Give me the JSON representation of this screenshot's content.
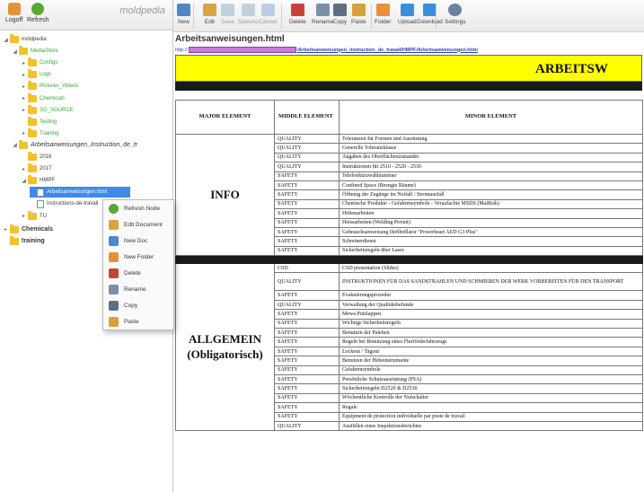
{
  "left_toolbar": {
    "logoff": "Logoff",
    "refresh": "Refresh",
    "logo": "moldpedia"
  },
  "tree": [
    {
      "label": "moldpedia",
      "indent": 0,
      "tw": "◢",
      "kind": "folder",
      "style": "root"
    },
    {
      "label": "MediaStore",
      "indent": 1,
      "tw": "◢",
      "kind": "folder",
      "style": "green"
    },
    {
      "label": "Configs",
      "indent": 2,
      "tw": "▸",
      "kind": "folder",
      "style": "green"
    },
    {
      "label": "Logs",
      "indent": 2,
      "tw": "▸",
      "kind": "folder",
      "style": "green"
    },
    {
      "label": "Pictures_Videos",
      "indent": 2,
      "tw": "▸",
      "kind": "folder",
      "style": "green"
    },
    {
      "label": "Chemicals",
      "indent": 2,
      "tw": "▸",
      "kind": "folder",
      "style": "green"
    },
    {
      "label": "SG_SOURCE",
      "indent": 2,
      "tw": "▸",
      "kind": "folder",
      "style": "green"
    },
    {
      "label": "Testing",
      "indent": 2,
      "tw": "",
      "kind": "folder",
      "style": "green"
    },
    {
      "label": "Training",
      "indent": 2,
      "tw": "▸",
      "kind": "folder",
      "style": "green"
    },
    {
      "label": "Arbeitsanweisungen_Instruction_de_tr",
      "indent": 1,
      "tw": "◢",
      "kind": "folder",
      "style": "big"
    },
    {
      "label": "2016",
      "indent": 2,
      "tw": "",
      "kind": "folder",
      "style": ""
    },
    {
      "label": "2017",
      "indent": 2,
      "tw": "▸",
      "kind": "folder",
      "style": ""
    },
    {
      "label": "HMPF",
      "indent": 2,
      "tw": "◢",
      "kind": "folder",
      "style": ""
    },
    {
      "label": "Arbeitsanweisungen.html",
      "indent": 3,
      "tw": "",
      "kind": "file",
      "style": "sel"
    },
    {
      "label": "Instructions-de-travail",
      "indent": 3,
      "tw": "",
      "kind": "file",
      "style": ""
    },
    {
      "label": "TU",
      "indent": 2,
      "tw": "▸",
      "kind": "folder",
      "style": ""
    },
    {
      "label": "Chemicals",
      "indent": 0,
      "tw": "▸",
      "kind": "folder",
      "style": "bold"
    },
    {
      "label": "training",
      "indent": 0,
      "tw": "",
      "kind": "folder",
      "style": "bold"
    }
  ],
  "context_menu": [
    {
      "label": "Refresh Node",
      "icon": "refresh-node-icon",
      "color": "#5aa832"
    },
    {
      "label": "Edit Document",
      "icon": "edit-document-icon",
      "color": "#d9a441"
    },
    {
      "label": "New Doc",
      "icon": "new-doc-icon",
      "color": "#4f86c6"
    },
    {
      "label": "New Folder",
      "icon": "new-folder-icon",
      "color": "#e8903a"
    },
    {
      "label": "Delete",
      "icon": "delete-icon",
      "color": "#c9413b"
    },
    {
      "label": "Rename",
      "icon": "rename-icon",
      "color": "#7b8fa8"
    },
    {
      "label": "Copy",
      "icon": "copy-icon",
      "color": "#5f6e80"
    },
    {
      "label": "Paste",
      "icon": "paste-icon",
      "color": "#d7a23a"
    }
  ],
  "toolbar": [
    {
      "label": "New",
      "icon": "new-icon",
      "color": "#4f86c6",
      "enabled": true
    },
    {
      "label": "Edit",
      "icon": "edit-icon",
      "color": "#d9a441",
      "enabled": true
    },
    {
      "label": "Save",
      "icon": "save-icon",
      "color": "#8aa2c4",
      "enabled": false
    },
    {
      "label": "SaveAs",
      "icon": "save-as-icon",
      "color": "#8aa2c4",
      "enabled": false
    },
    {
      "label": "Cancel",
      "icon": "cancel-icon",
      "color": "#6ea0d8",
      "enabled": false
    },
    {
      "label": "Delete",
      "icon": "delete-icon",
      "color": "#c9413b",
      "enabled": true
    },
    {
      "label": "Rename",
      "icon": "rename-icon",
      "color": "#7b8fa8",
      "enabled": true
    },
    {
      "label": "Copy",
      "icon": "copy-icon",
      "color": "#5f6e80",
      "enabled": true
    },
    {
      "label": "Paste",
      "icon": "paste-icon",
      "color": "#d7a23a",
      "enabled": true
    },
    {
      "label": "Folder",
      "icon": "folder-icon",
      "color": "#e8903a",
      "enabled": true
    },
    {
      "label": "Upload",
      "icon": "upload-icon",
      "color": "#3a8fd9",
      "enabled": true
    },
    {
      "label": "Download",
      "icon": "download-icon",
      "color": "#3a8fd9",
      "enabled": true
    },
    {
      "label": "Settings",
      "icon": "gear-icon",
      "color": "#6b7fa3",
      "enabled": true
    }
  ],
  "document": {
    "title": "Arbeitsanweisungen.html",
    "url_prefix": "http://",
    "url_rest": "/Arbeitsanweisungen_Instruction_de_travail/HMPF/Arbeitsanweisungen.html",
    "banner": "ARBEITSW",
    "headers": {
      "major": "MAJOR ELEMENT",
      "middle": "MIDDLE ELEMENT",
      "minor": "MINOR ELEMENT"
    },
    "section1": {
      "major": "INFO",
      "rows": [
        {
          "middle": "QUALITY",
          "minor": "Toleranzen für Formen und Ausrüstung"
        },
        {
          "middle": "QUALITY",
          "minor": "Generelle Toleranzklasse"
        },
        {
          "middle": "QUALITY",
          "minor": "Angaben des Oberflächenzustandes"
        },
        {
          "middle": "QUALITY",
          "minor": "Instruktionen für 2510 - 2520 - 2530"
        },
        {
          "middle": "SAFETY",
          "minor": "Telefonkurzwahlnummer"
        },
        {
          "middle": "SAFETY",
          "minor": "Confined Space (Beengte Räume)"
        },
        {
          "middle": "SAFETY",
          "minor": "Öffnung der Zugänge im Notfall / Stromausfall"
        },
        {
          "middle": "SAFETY",
          "minor": "Chemische Produkte - Gefahrensymbole - Veraufachte MSDS (MatRisk)"
        },
        {
          "middle": "SAFETY",
          "minor": "Höhenarbeiten"
        },
        {
          "middle": "SAFETY",
          "minor": "Heissarbeiten (Welding Permit)"
        },
        {
          "middle": "SAFETY",
          "minor": "Gebrauchsanweisung Defibrillator \"Powerheart AED G3 Plus\""
        },
        {
          "middle": "SAFETY",
          "minor": "Schreinerdienst"
        },
        {
          "middle": "SAFETY",
          "minor": "Sicherheitsregeln über Laser"
        }
      ]
    },
    "section2": {
      "major": "ALLGEMEIN (Obligatorisch)",
      "rows": [
        {
          "middle": "CSD",
          "minor": "CSD presentation (Slides)"
        },
        {
          "middle": "QUALITY",
          "minor": "INSTRUKTIONEN FÜR DAS SANDSTRAHLEN UND SCHMIEREN DER WERK VORBEREITEN FÜR DEN TRANSPORT",
          "tall": true
        },
        {
          "middle": "SAFETY",
          "minor": "Evakuierungsprozedur"
        },
        {
          "middle": "QUALITY",
          "minor": "Verwaltung der Qualitätsbefunde"
        },
        {
          "middle": "SAFETY",
          "minor": "Mewa Putzlappen"
        },
        {
          "middle": "SAFETY",
          "minor": "Wichtige Sicherheitsregeln"
        },
        {
          "middle": "SAFETY",
          "minor": "Benutzen der Paletten"
        },
        {
          "middle": "SAFETY",
          "minor": "Regeln bei Benutzung eines Flurförderfahrzeugs"
        },
        {
          "middle": "SAFETY",
          "minor": "Lockout / Tagout"
        },
        {
          "middle": "SAFETY",
          "minor": "Benutzen der Hebeinstrumente"
        },
        {
          "middle": "SAFETY",
          "minor": "Gefahrensymbole"
        },
        {
          "middle": "SAFETY",
          "minor": "Persönliche Schutzausrüstung (PSA)"
        },
        {
          "middle": "SAFETY",
          "minor": "Sicherheitsregeln D2520 & D2530"
        },
        {
          "middle": "SAFETY",
          "minor": "Wöchentliche Kontrolle der Notschalter"
        },
        {
          "middle": "SAFETY",
          "minor": "Regale"
        },
        {
          "middle": "SAFETY",
          "minor": "Equipment de protection individuelle par poste de travail"
        },
        {
          "middle": "QUALITY",
          "minor": "Ausfüllen eines Inspektionsberichtes"
        }
      ]
    }
  }
}
